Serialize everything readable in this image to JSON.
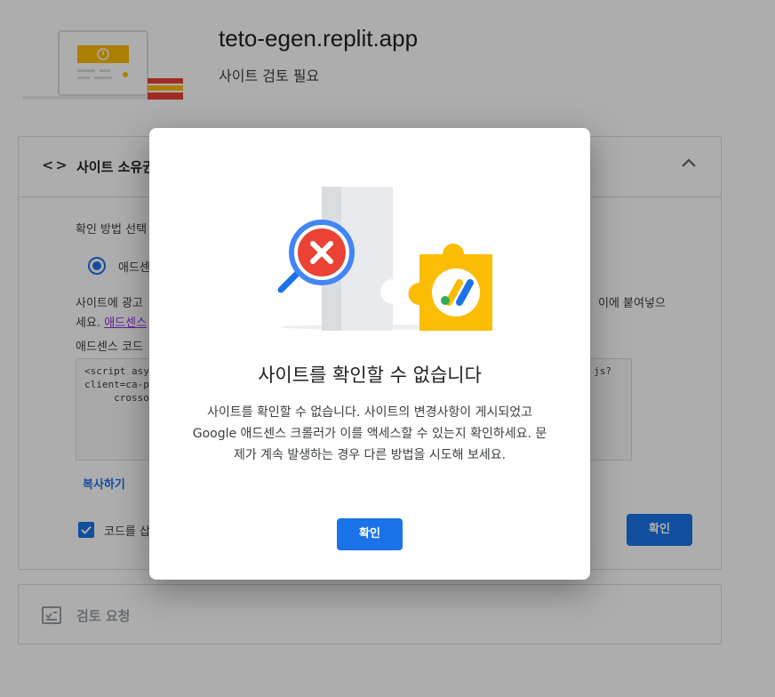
{
  "site": {
    "domain": "teto-egen.replit.app",
    "status": "사이트 검토 필요"
  },
  "ownership_card": {
    "title": "사이트 소유권",
    "method_label": "확인 방법 선택",
    "radio_label": "애드센",
    "description_line1": "사이트에 광고",
    "description_line1_tail": "이에 붙여넣으",
    "description_line2_prefix": "세요. ",
    "description_link": "애드센스",
    "code_label": "애드센스 코드",
    "code_lines": [
      "<script asy",
      "client=ca-p",
      "     crosso"
    ],
    "code_tail": "js?",
    "copy_label": "복사하기",
    "checkbox_label": "코드를 삽",
    "confirm_label": "확인"
  },
  "review_card": {
    "title": "검토 요청"
  },
  "dialog": {
    "title": "사이트를 확인할 수 없습니다",
    "body": "사이트를 확인할 수 없습니다. 사이트의 변경사항이 게시되었고 Google 애드센스 크롤러가 이를 액세스할 수 있는지 확인하세요. 문제가 계속 발생하는 경우 다른 방법을 시도해 보세요.",
    "button_label": "확인"
  },
  "colors": {
    "primary": "#1a73e8",
    "error": "#ea4335",
    "adsense_yellow": "#fbbc04",
    "overlay": "rgba(0,0,0,0.32)"
  },
  "icons": {
    "code": "code-brackets-icon",
    "collapse": "chevron-up-icon",
    "review": "checklist-icon",
    "illustration": "magnifier-error-puzzle-icon"
  }
}
